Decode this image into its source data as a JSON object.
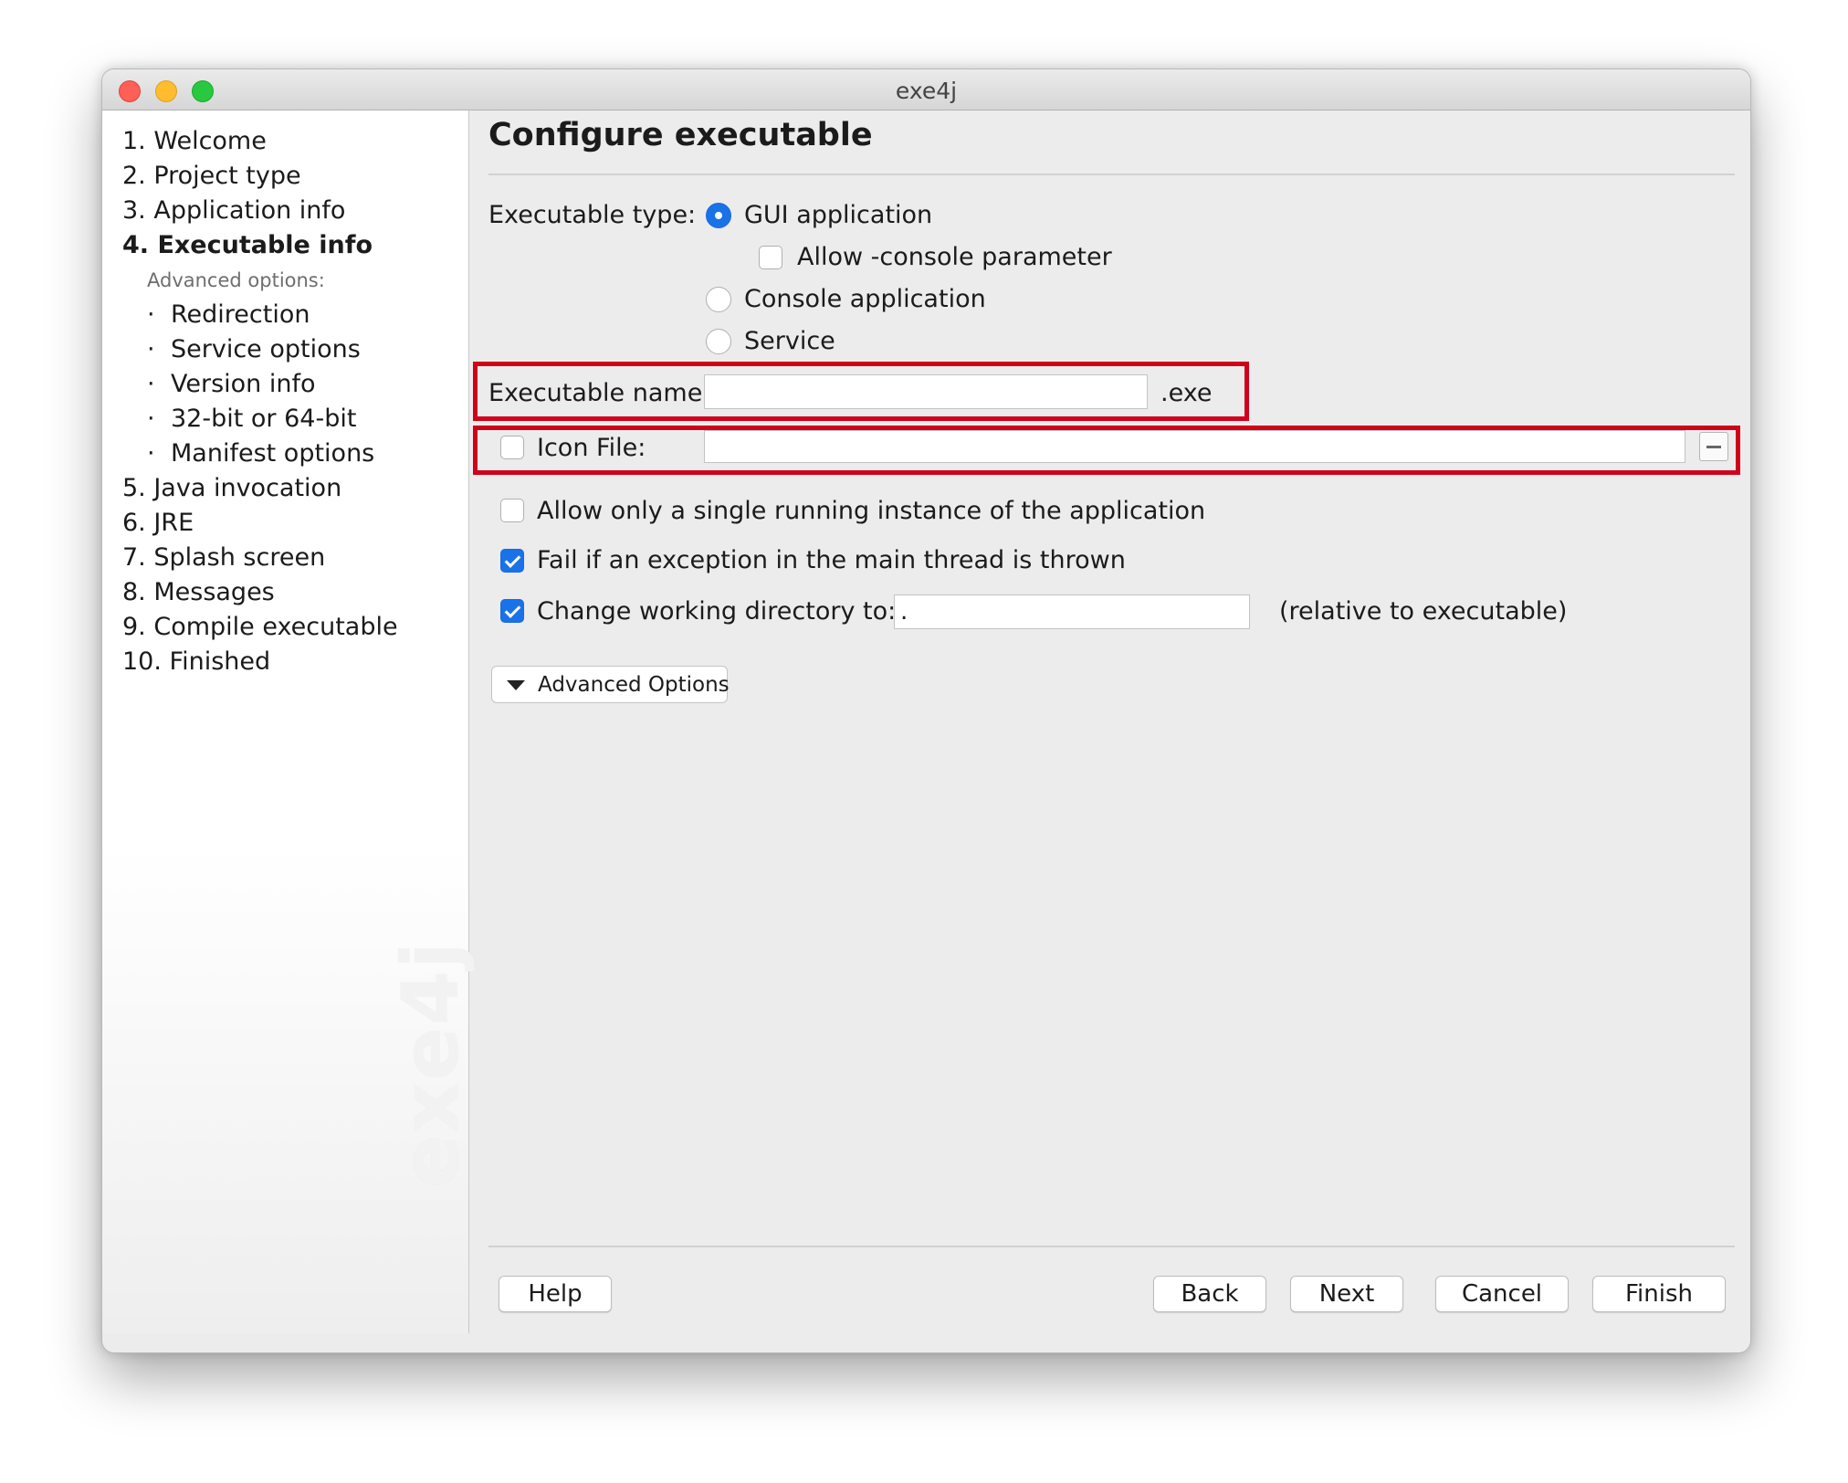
{
  "window": {
    "title": "exe4j"
  },
  "sidebar": {
    "steps": [
      "1. Welcome",
      "2. Project type",
      "3. Application info",
      "4. Executable info",
      "5. Java invocation",
      "6. JRE",
      "7. Splash screen",
      "8. Messages",
      "9. Compile executable",
      "10. Finished"
    ],
    "current_step": "4. Executable info",
    "advanced_heading": "Advanced options:",
    "advanced_items": [
      "Redirection",
      "Service options",
      "Version info",
      "32-bit or 64-bit",
      "Manifest options"
    ],
    "bullet": "·",
    "logo_text": "exe4j"
  },
  "main": {
    "title": "Configure executable",
    "executable_type": {
      "label": "Executable type:",
      "options": [
        "GUI application",
        "Console application",
        "Service"
      ],
      "selected": "GUI application",
      "allow_console_label": "Allow -console parameter",
      "allow_console_checked": false
    },
    "executable_name": {
      "label": "Executable name:",
      "value": "",
      "suffix": ".exe"
    },
    "icon_file": {
      "label": "Icon File:",
      "checked": false,
      "value": ""
    },
    "single_instance": {
      "label": "Allow only a single running instance of the application",
      "checked": false
    },
    "fail_exception": {
      "label": "Fail if an exception in the main thread is thrown",
      "checked": true
    },
    "working_dir": {
      "label": "Change working directory to:",
      "checked": true,
      "value": ".",
      "note": "(relative to executable)"
    },
    "advanced_button": "Advanced Options"
  },
  "footer": {
    "help": "Help",
    "back": "Back",
    "next": "Next",
    "cancel": "Cancel",
    "finish": "Finish"
  },
  "colors": {
    "accent": "#1a72e8",
    "highlight": "#d0021b"
  }
}
